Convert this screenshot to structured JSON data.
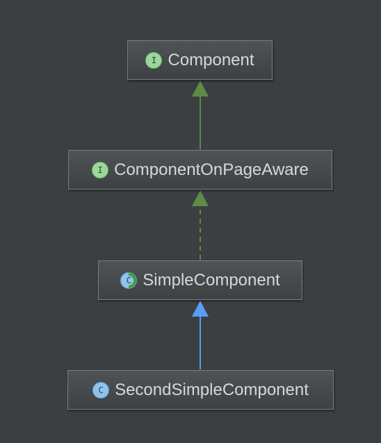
{
  "diagram": {
    "nodes": [
      {
        "id": "component",
        "label": "Component",
        "kind": "interface",
        "badge": "I"
      },
      {
        "id": "component-on-page-aware",
        "label": "ComponentOnPageAware",
        "kind": "interface",
        "badge": "I"
      },
      {
        "id": "simple-component",
        "label": "SimpleComponent",
        "kind": "abstract-class",
        "badge": "C"
      },
      {
        "id": "second-simple-component",
        "label": "SecondSimpleComponent",
        "kind": "class",
        "badge": "C"
      }
    ],
    "edges": [
      {
        "from": "component-on-page-aware",
        "to": "component",
        "relation": "extends",
        "style": "solid",
        "color": "#5c8c48"
      },
      {
        "from": "simple-component",
        "to": "component-on-page-aware",
        "relation": "implements",
        "style": "dashed",
        "color": "#5c8c48"
      },
      {
        "from": "second-simple-component",
        "to": "simple-component",
        "relation": "extends",
        "style": "solid",
        "color": "#589df6"
      }
    ]
  },
  "colors": {
    "background": "#3c3f41",
    "node_border": "#7b7f82",
    "text": "#d6d8d9",
    "interface_badge": "#9bd69a",
    "class_badge": "#8fc3ea"
  }
}
